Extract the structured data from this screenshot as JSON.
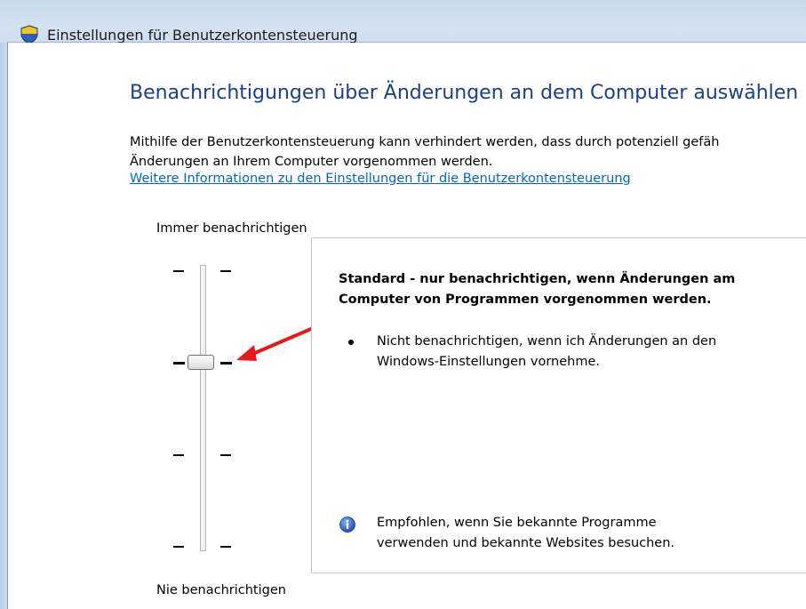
{
  "window": {
    "title": "Einstellungen für Benutzerkontensteuerung",
    "icon": "uac-shield-icon"
  },
  "main": {
    "heading": "Benachrichtigungen über Änderungen an dem Computer auswählen",
    "description_line1": "Mithilfe der Benutzerkontensteuerung kann verhindert werden, dass durch potenziell gefäh",
    "description_line2": "Änderungen an Ihrem Computer vorgenommen werden.",
    "link": "Weitere Informationen zu den Einstellungen für die Benutzerkontensteuerung"
  },
  "slider": {
    "top_label": "Immer benachrichtigen",
    "bottom_label": "Nie benachrichtigen",
    "levels": 4,
    "selected_level": 2
  },
  "panel": {
    "title_line1": "Standard - nur benachrichtigen, wenn Änderungen am",
    "title_line2": "Computer von Programmen vorgenommen werden.",
    "bullet_line1": "Nicht benachrichtigen, wenn ich Änderungen an den",
    "bullet_line2": "Windows-Einstellungen vornehme.",
    "info_line1": "Empfohlen, wenn Sie bekannte Programme",
    "info_line2": "verwenden und bekannte Websites besuchen.",
    "info_icon": "info-icon"
  },
  "colors": {
    "heading": "#1e3e87",
    "link": "#0066cc",
    "annotation_arrow": "#e8191c"
  }
}
